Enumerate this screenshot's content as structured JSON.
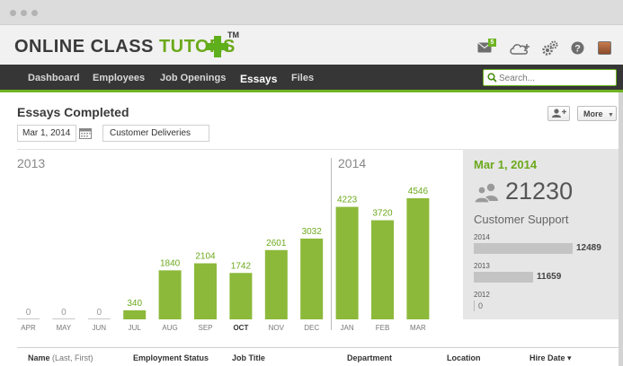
{
  "header": {
    "logo_part1": "ONLINE CLASS ",
    "logo_part2": "TUTORS",
    "trademark": "TM",
    "mail_badge": "5",
    "icons": [
      "mail-icon",
      "cloud-add-icon",
      "gears-icon",
      "help-icon",
      "avatar"
    ]
  },
  "nav": {
    "items": [
      "Dashboard",
      "Employees",
      "Job Openings",
      "Essays",
      "Files"
    ],
    "active": "Essays",
    "search_placeholder": "Search..."
  },
  "page": {
    "title": "Essays Completed",
    "more_label": "More",
    "date": "Mar 1, 2014",
    "filter": "Customer Deliveries"
  },
  "chart_data": {
    "type": "bar",
    "year_labels": [
      "2013",
      "2014"
    ],
    "categories": [
      "APR",
      "MAY",
      "JUN",
      "JUL",
      "AUG",
      "SEP",
      "OCT",
      "NOV",
      "DEC",
      "JAN",
      "FEB",
      "MAR"
    ],
    "values": [
      0,
      0,
      0,
      340,
      1840,
      2104,
      1742,
      2601,
      3032,
      4223,
      3720,
      4546
    ],
    "highlight_category": "OCT",
    "bar_color": "#8cb93a",
    "zero_color": "#999999",
    "ylim": [
      0,
      4546
    ]
  },
  "panel": {
    "date": "Mar 1, 2014",
    "count": "21230",
    "label": "Customer Support",
    "years": [
      {
        "year": "2014",
        "value": "12489",
        "fraction": 1.0
      },
      {
        "year": "2013",
        "value": "11659",
        "fraction": 0.6
      },
      {
        "year": "2012",
        "value": "0",
        "fraction": 0
      }
    ]
  },
  "table": {
    "headers": [
      {
        "label": "Name",
        "sub": "(Last, First)"
      },
      {
        "label": "Employment Status"
      },
      {
        "label": "Job Title"
      },
      {
        "label": "Department"
      },
      {
        "label": "Location"
      },
      {
        "label": "Hire Date ▾"
      }
    ]
  },
  "colors": {
    "accent": "#6fb421",
    "nav_bg": "#363636",
    "panel_bg": "#e6e6e6"
  }
}
